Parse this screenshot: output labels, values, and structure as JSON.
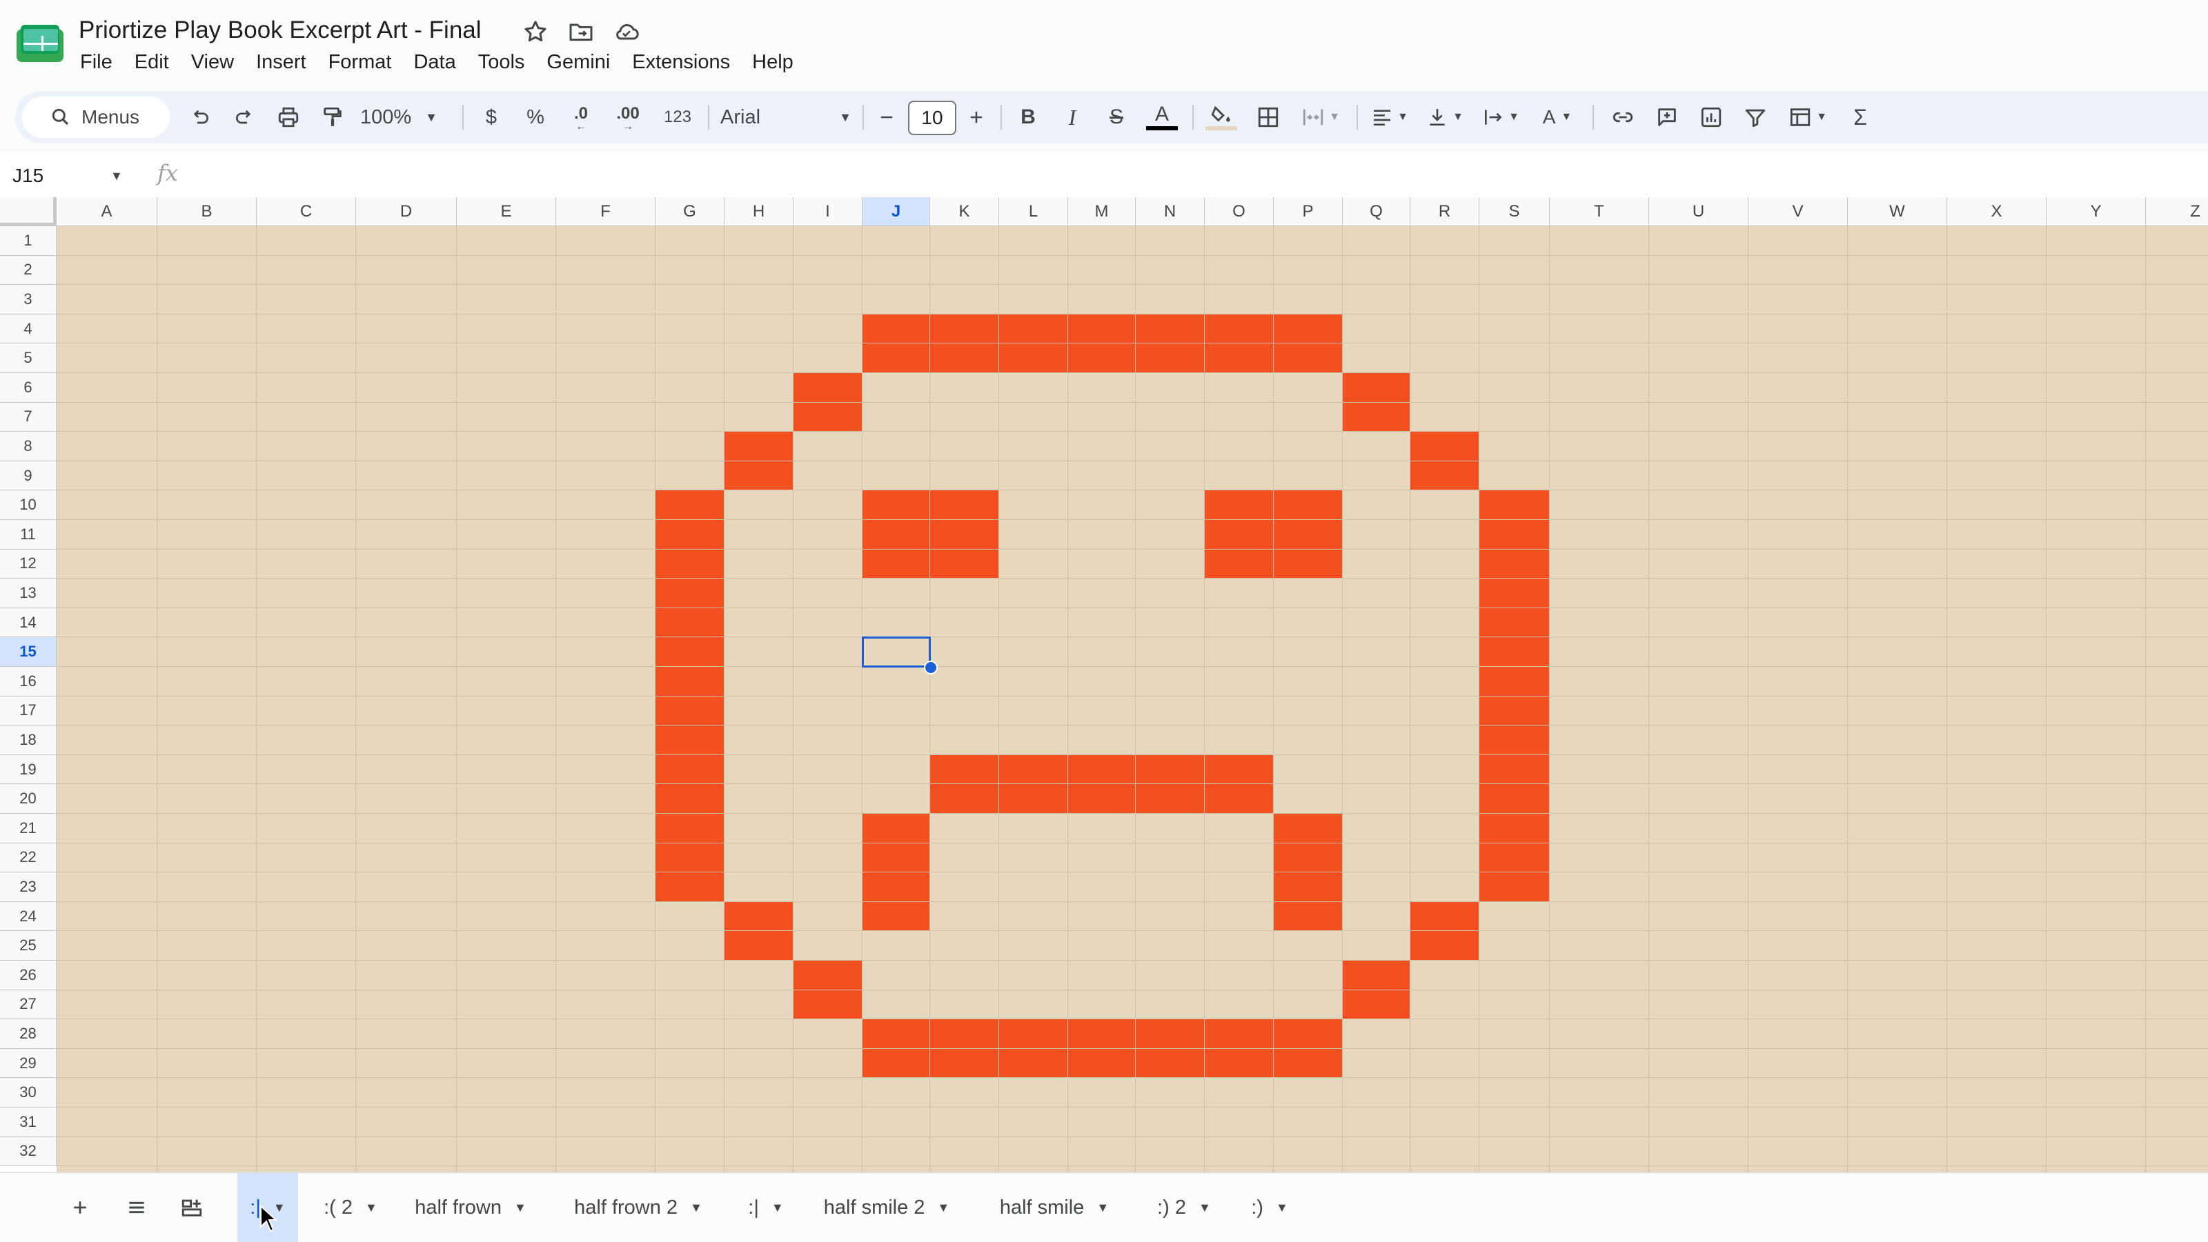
{
  "document": {
    "title": "Priortize Play Book Excerpt Art - Final"
  },
  "menu": [
    "File",
    "Edit",
    "View",
    "Insert",
    "Format",
    "Data",
    "Tools",
    "Gemini",
    "Extensions",
    "Help"
  ],
  "toolbar": {
    "search_label": "Menus",
    "zoom": "100%",
    "currency": "$",
    "percent": "%",
    "decrease_decimal": ".0",
    "increase_decimal": ".00",
    "number_format": "123",
    "font": "Arial",
    "font_size": "10"
  },
  "formula_bar": {
    "cell_ref": "J15",
    "fx": "fx",
    "formula": ""
  },
  "columns": [
    "A",
    "B",
    "C",
    "D",
    "E",
    "F",
    "G",
    "H",
    "I",
    "J",
    "K",
    "L",
    "M",
    "N",
    "O",
    "P",
    "Q",
    "R",
    "S",
    "T",
    "U",
    "V",
    "W",
    "X",
    "Y",
    "Z"
  ],
  "rows": [
    "1",
    "2",
    "3",
    "4",
    "5",
    "6",
    "7",
    "8",
    "9",
    "10",
    "11",
    "12",
    "13",
    "14",
    "15",
    "16",
    "17",
    "18",
    "19",
    "20",
    "21",
    "22",
    "23",
    "24",
    "25",
    "26",
    "27",
    "28",
    "29",
    "30",
    "31",
    "32"
  ],
  "selected_cell": {
    "column": "J",
    "row": "15"
  },
  "colors": {
    "sheet_background": "#e6d8bf",
    "pixel_fill": "#f44f1f",
    "selection": "#1a5dd6"
  },
  "filled_cells": [
    {
      "cols": "J:P",
      "rows": "4:5"
    },
    {
      "cols": "I:I",
      "rows": "6:7"
    },
    {
      "cols": "Q:Q",
      "rows": "6:7"
    },
    {
      "cols": "H:H",
      "rows": "8:9"
    },
    {
      "cols": "R:R",
      "rows": "8:9"
    },
    {
      "cols": "G:G",
      "rows": "10:23"
    },
    {
      "cols": "S:S",
      "rows": "10:23"
    },
    {
      "cols": "J:K",
      "rows": "10:12"
    },
    {
      "cols": "O:P",
      "rows": "10:12"
    },
    {
      "cols": "K:O",
      "rows": "19:20"
    },
    {
      "cols": "J:J",
      "rows": "21:24"
    },
    {
      "cols": "P:P",
      "rows": "21:24"
    },
    {
      "cols": "H:H",
      "rows": "24:25"
    },
    {
      "cols": "R:R",
      "rows": "24:25"
    },
    {
      "cols": "I:I",
      "rows": "26:27"
    },
    {
      "cols": "Q:Q",
      "rows": "26:27"
    },
    {
      "cols": "J:P",
      "rows": "28:29"
    }
  ],
  "sheet_tabs": [
    ":|",
    ":( 2",
    "half frown",
    "half frown 2",
    ":|",
    "half smile 2",
    "half smile",
    ":) 2",
    ":)"
  ],
  "active_tab_index": 0
}
